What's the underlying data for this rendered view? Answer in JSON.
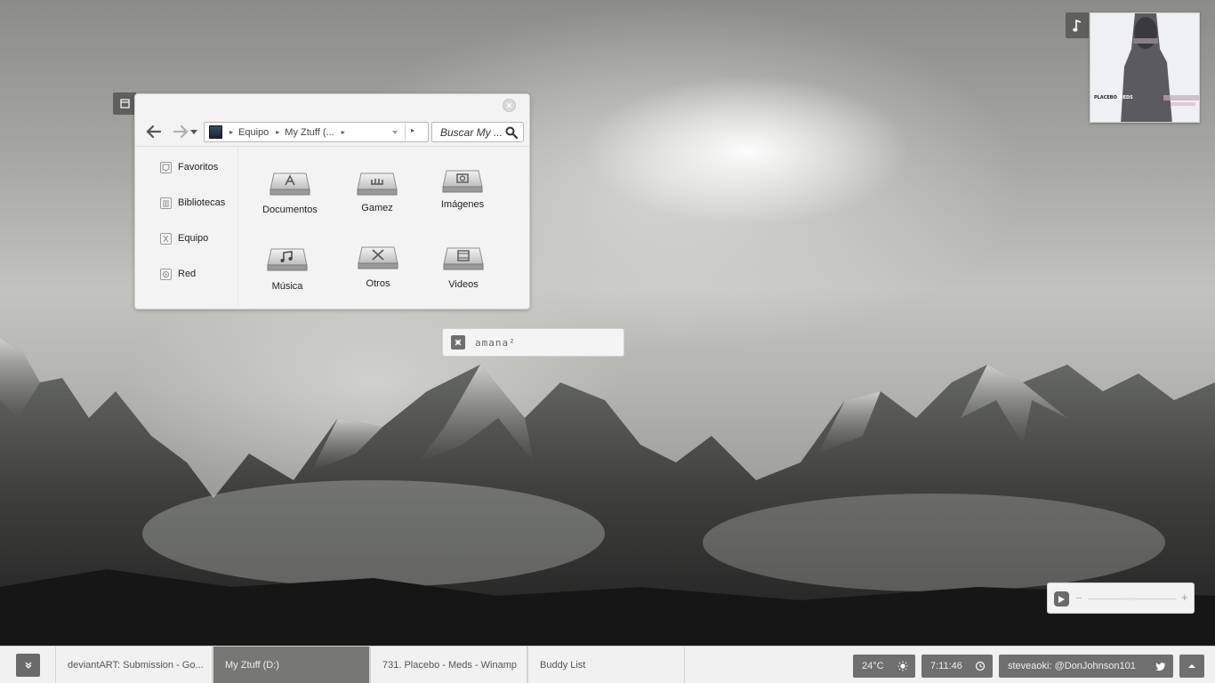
{
  "explorer": {
    "address": {
      "crumbs": [
        "Equipo",
        "My Ztuff (..."
      ]
    },
    "search_placeholder": "Buscar My ...",
    "sidebar": [
      {
        "label": "Favoritos",
        "icon": "favorites-icon"
      },
      {
        "label": "Bibliotecas",
        "icon": "libraries-icon"
      },
      {
        "label": "Equipo",
        "icon": "computer-icon"
      },
      {
        "label": "Red",
        "icon": "network-icon"
      }
    ],
    "folders": [
      {
        "label": "Documentos",
        "icon": "documents-drive-icon"
      },
      {
        "label": "Gamez",
        "icon": "games-drive-icon"
      },
      {
        "label": "Imágenes",
        "icon": "pictures-drive-icon"
      },
      {
        "label": "Música",
        "icon": "music-drive-icon"
      },
      {
        "label": "Otros",
        "icon": "tools-drive-icon"
      },
      {
        "label": "Videos",
        "icon": "videos-drive-icon"
      }
    ]
  },
  "tag_widget": {
    "text": "amana²"
  },
  "album": {
    "caption_a": "PLACEBO",
    "caption_b": "MEDS"
  },
  "taskbar": {
    "tasks": [
      {
        "label": "deviantART: Submission - Go..."
      },
      {
        "label": "My Ztuff (D:)",
        "active": true
      },
      {
        "label": "731. Placebo - Meds - Winamp"
      },
      {
        "label": "Buddy List"
      }
    ],
    "weather": "24°C",
    "clock": "7:11:46",
    "twitter": "steveaoki: @DonJohnson101"
  },
  "colors": {
    "accent": "#6f6f6f",
    "active_task": "#777876",
    "window_bg": "#f3f3f3"
  }
}
